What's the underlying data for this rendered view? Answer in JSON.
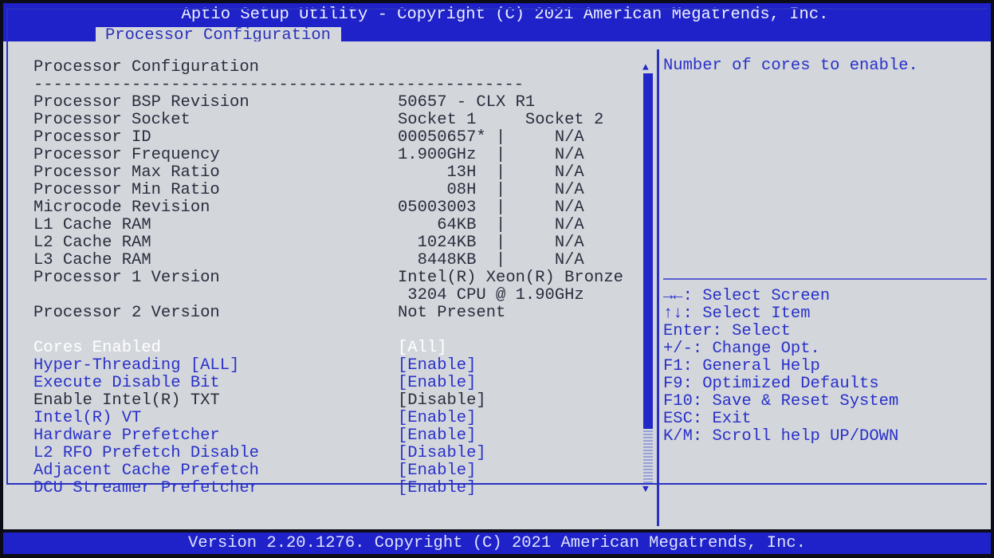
{
  "header": {
    "title": "Aptio Setup Utility - Copyright (C) 2021 American Megatrends, Inc.",
    "tab": "Processor Configuration"
  },
  "main": {
    "section_title": "Processor Configuration",
    "separator": "--------------------------------------------------",
    "info_rows": [
      {
        "label": "Processor BSP Revision",
        "value": "50657 - CLX R1"
      },
      {
        "label": "Processor Socket",
        "value": "Socket 1     Socket 2"
      },
      {
        "label": "Processor ID",
        "value": "00050657* |     N/A"
      },
      {
        "label": "Processor Frequency",
        "value": "1.900GHz  |     N/A"
      },
      {
        "label": "Processor Max Ratio",
        "value": "     13H  |     N/A"
      },
      {
        "label": "Processor Min Ratio",
        "value": "     08H  |     N/A"
      },
      {
        "label": "Microcode Revision",
        "value": "05003003  |     N/A"
      },
      {
        "label": "L1 Cache RAM",
        "value": "    64KB  |     N/A"
      },
      {
        "label": "L2 Cache RAM",
        "value": "  1024KB  |     N/A"
      },
      {
        "label": "L3 Cache RAM",
        "value": "  8448KB  |     N/A"
      },
      {
        "label": "Processor 1 Version",
        "value": "Intel(R) Xeon(R) Bronze"
      },
      {
        "label": "",
        "value": " 3204 CPU @ 1.90GHz"
      },
      {
        "label": "Processor 2 Version",
        "value": "Not Present"
      }
    ],
    "settings": [
      {
        "label": "Cores Enabled",
        "value": "[All]",
        "selected": true
      },
      {
        "label": "Hyper-Threading [ALL]",
        "value": "[Enable]"
      },
      {
        "label": "Execute Disable Bit",
        "value": "[Enable]"
      },
      {
        "label": "Enable Intel(R) TXT",
        "value": "[Disable]",
        "disabled": true
      },
      {
        "label": "Intel(R) VT",
        "value": "[Enable]"
      },
      {
        "label": "Hardware Prefetcher",
        "value": "[Enable]"
      },
      {
        "label": "L2 RFO Prefetch Disable",
        "value": "[Disable]"
      },
      {
        "label": "Adjacent Cache Prefetch",
        "value": "[Enable]"
      },
      {
        "label": "DCU Streamer Prefetcher",
        "value": "[Enable]"
      }
    ]
  },
  "help": {
    "description": "Number of cores to enable.",
    "keys": [
      "→←: Select Screen",
      "↑↓: Select Item",
      "Enter: Select",
      "+/-: Change Opt.",
      "F1: General Help",
      "F9: Optimized Defaults",
      "F10: Save & Reset System",
      "ESC: Exit",
      "K/M: Scroll help UP/DOWN"
    ]
  },
  "footer": {
    "text": "Version 2.20.1276. Copyright (C) 2021 American Megatrends, Inc."
  },
  "colors": {
    "bar": "#1e22c8",
    "panel": "#d3d7dc",
    "accent": "#2a30c8",
    "selected": "#ffffff"
  }
}
